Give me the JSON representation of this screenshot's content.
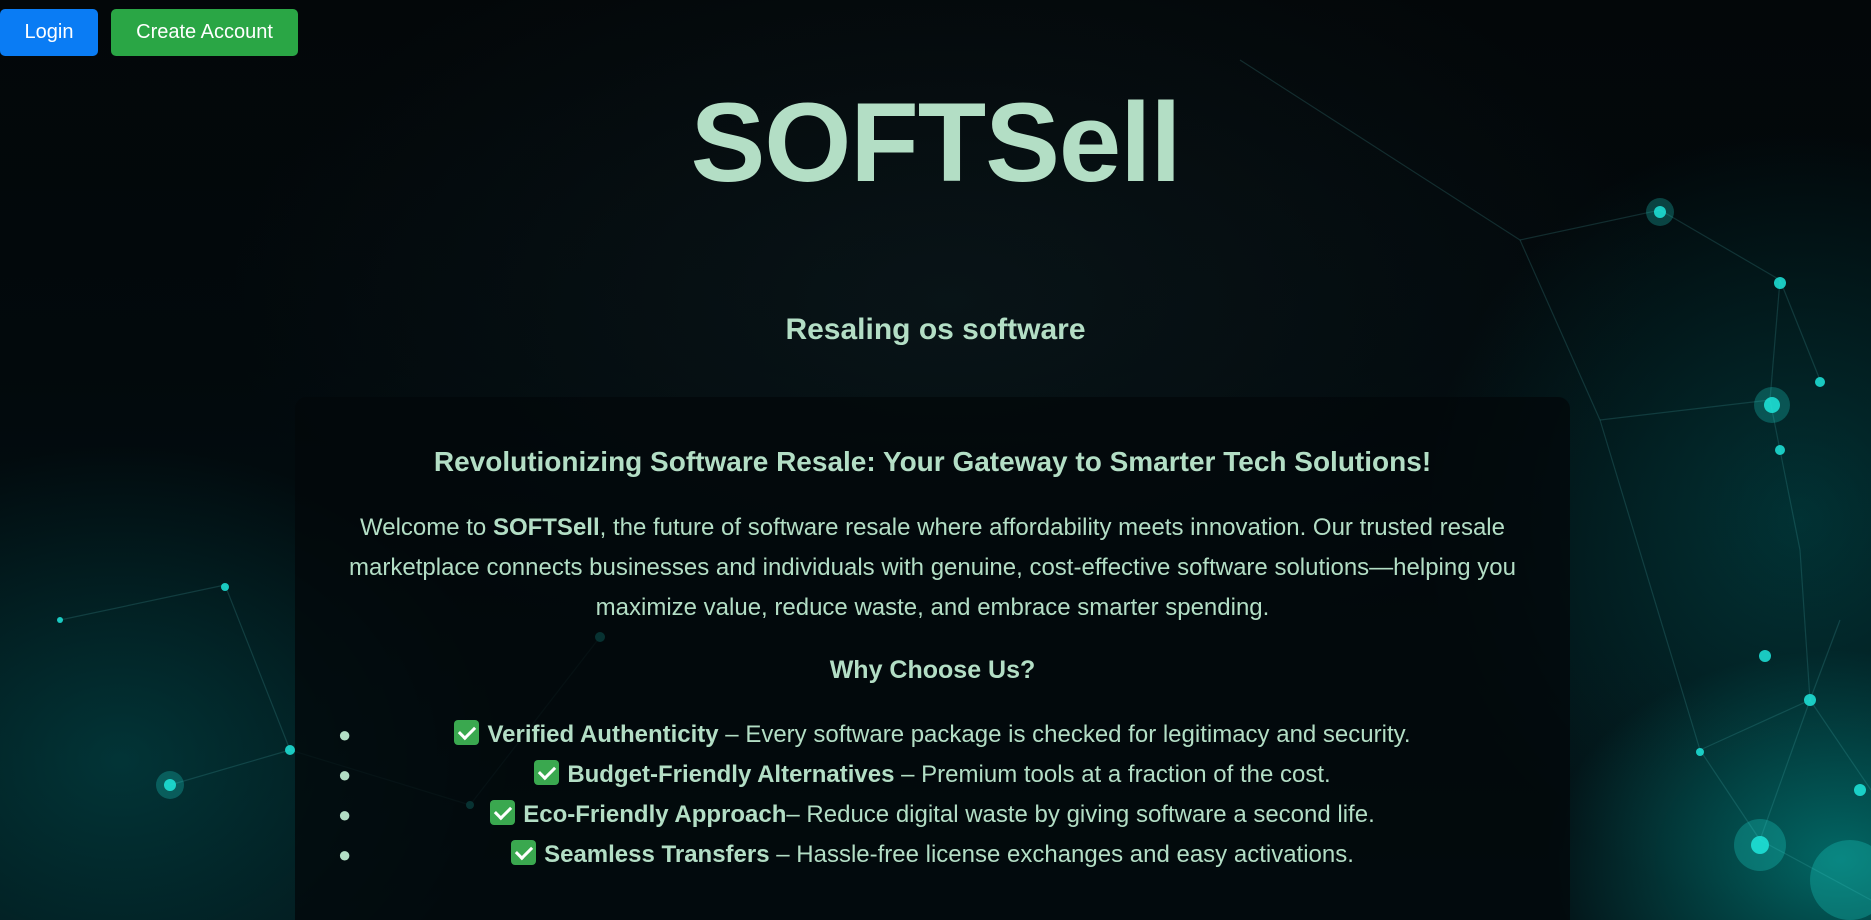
{
  "auth": {
    "login_label": "Login",
    "create_account_label": "Create Account"
  },
  "hero": {
    "title": "SOFTSell",
    "subtitle": "Resaling os software"
  },
  "card": {
    "heading": "Revolutionizing Software Resale: Your Gateway to Smarter Tech Solutions!",
    "intro_prefix": "Welcome to ",
    "intro_brand": "SOFTSell",
    "intro_rest": ", the future of software resale where affordability meets innovation. Our trusted resale marketplace connects businesses and individuals with genuine, cost-effective software solutions—helping you maximize value, reduce waste, and embrace smarter spending.",
    "why_heading": "Why Choose Us?",
    "features": [
      {
        "title": "Verified Authenticity",
        "desc": " – Every software package is checked for legitimacy and security."
      },
      {
        "title": "Budget-Friendly Alternatives",
        "desc": " – Premium tools at a fraction of the cost."
      },
      {
        "title": "Eco-Friendly Approach",
        "desc": "– Reduce digital waste by giving software a second life."
      },
      {
        "title": "Seamless Transfers",
        "desc": " – Hassle-free license exchanges and easy activations."
      }
    ]
  },
  "icons": {
    "feature_icon": "check-mark-button-icon"
  },
  "colors": {
    "title_text": "#b3dec5",
    "login_button": "#0a7cf4",
    "create_button": "#2aa645",
    "background": "#010c0f"
  }
}
